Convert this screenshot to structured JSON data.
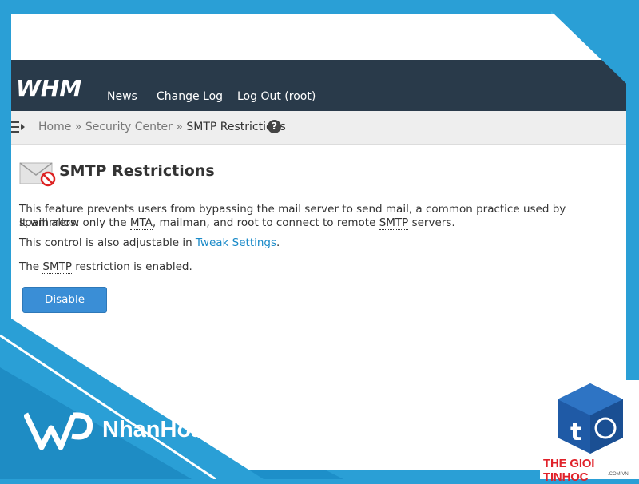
{
  "header": {
    "logo": "WHM",
    "nav": [
      "News",
      "Change Log",
      "Log Out (root)"
    ]
  },
  "breadcrumb": {
    "items": [
      "Home",
      "Security Center",
      "SMTP Restrictions"
    ],
    "separator": "»"
  },
  "page": {
    "title": "SMTP Restrictions",
    "desc_line1": "This feature prevents users from bypassing the mail server to send mail, a common practice used by spammers.",
    "desc_line2_a": "It will allow only the ",
    "desc_line2_mta": "MTA",
    "desc_line2_b": ", mailman, and root to connect to remote ",
    "desc_line2_smtp": "SMTP",
    "desc_line2_c": " servers.",
    "tweak_prefix": "This control is also adjustable in ",
    "tweak_link": "Tweak Settings",
    "tweak_suffix": ".",
    "status_prefix": "The ",
    "status_smtp": "SMTP",
    "status_suffix": " restriction is enabled.",
    "disable_button": "Disable"
  },
  "watermarks": {
    "nhanhoa": "NhanHoa",
    "thegioitinhoc": "THE GIOI TINHOC",
    "thegioitinhoc_sub": ".COM.VN"
  },
  "colors": {
    "header_bg": "#293a4a",
    "accent": "#3a8ed6",
    "link": "#1a8ac8",
    "frame": "#2a9fd6"
  }
}
